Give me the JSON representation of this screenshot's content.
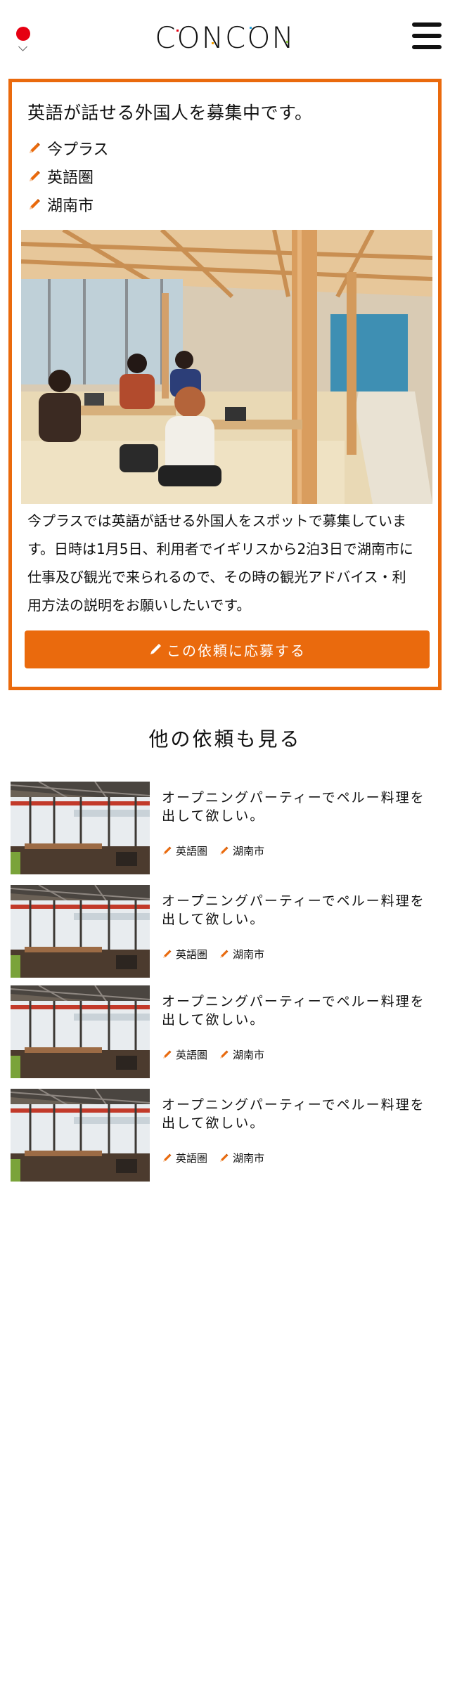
{
  "header": {
    "logo_text": "CONCON",
    "language_icon": "japan-flag-icon",
    "menu_icon": "hamburger-menu-icon"
  },
  "request": {
    "title": "英語が話せる外国人を募集中です。",
    "tags": [
      "今プラス",
      "英語圏",
      "湖南市"
    ],
    "tag_icon": "pencil-icon",
    "body_lines": [
      "今プラスでは英語が話せる外国人をスポットで募集していま",
      "す。日時は1月5日、利用者でイギリスから2泊3日で湖南市に",
      "仕事及び観光で来られるので、その時の観光アドバイス・利",
      "用方法の説明をお願いしたいです。"
    ],
    "apply_label": "この依頼に応募する"
  },
  "others": {
    "heading": "他の依頼も見る",
    "items": [
      {
        "title_lines": [
          "オープニングパーティーでペルー料理を",
          "出して欲しい。"
        ],
        "tags": [
          "英語圏",
          "湖南市"
        ]
      },
      {
        "title_lines": [
          "オープニングパーティーでペルー料理を",
          "出して欲しい。"
        ],
        "tags": [
          "英語圏",
          "湖南市"
        ]
      },
      {
        "title_lines": [
          "オープニングパーティーでペルー料理を",
          "出して欲しい。"
        ],
        "tags": [
          "英語圏",
          "湖南市"
        ]
      },
      {
        "title_lines": [
          "オープニングパーティーでペルー料理を",
          "出して欲しい。"
        ],
        "tags": [
          "英語圏",
          "湖南市"
        ]
      }
    ]
  },
  "colors": {
    "accent": "#ea6a0d",
    "flag_red": "#e60012"
  }
}
